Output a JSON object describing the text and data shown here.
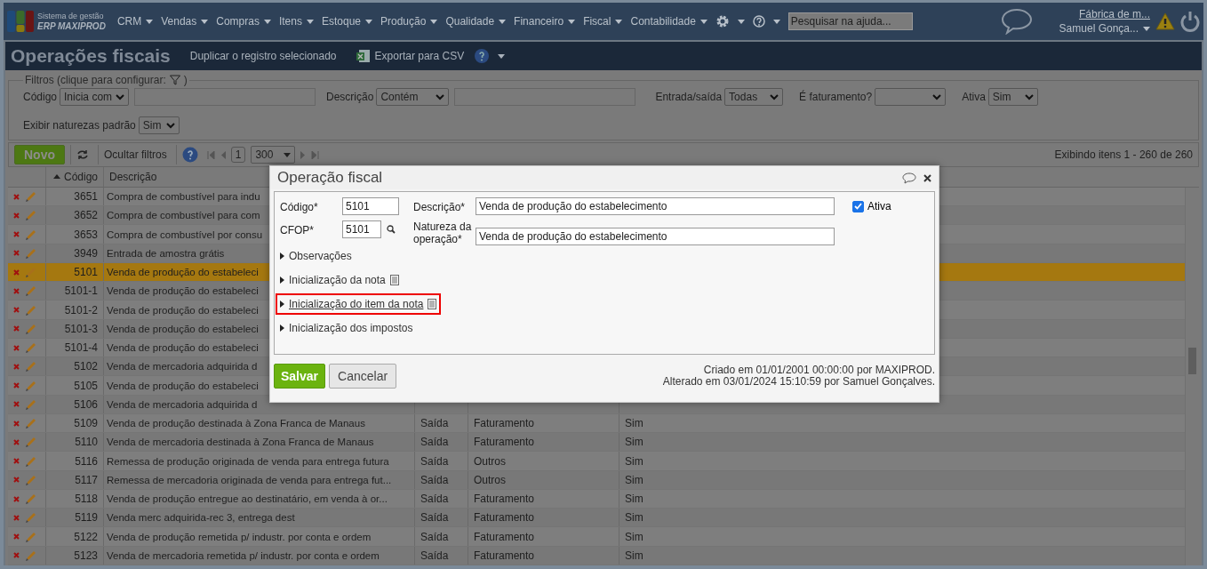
{
  "nav": {
    "brand_top": "Sistema de gestão",
    "brand_bottom": "ERP MAXIPROD",
    "menus": [
      "CRM",
      "Vendas",
      "Compras",
      "Itens",
      "Estoque",
      "Produção",
      "Qualidade",
      "Financeiro",
      "Fiscal",
      "Contabilidade"
    ],
    "search_placeholder": "Pesquisar na ajuda...",
    "company": "Fábrica de m...",
    "user": "Samuel Gonça..."
  },
  "page": {
    "title": "Operações fiscais",
    "actions": [
      "Duplicar o registro selecionado",
      "Exportar para CSV"
    ]
  },
  "filters": {
    "legend": "Filtros (clique para configurar:",
    "legend_end": ")",
    "fields": [
      {
        "label": "Código",
        "kind": "operator",
        "select": "Inicia com"
      },
      {
        "label": "Descrição",
        "kind": "operator",
        "select": "Contém"
      },
      {
        "label": "Entrada/saída",
        "kind": "select",
        "select": "Todas"
      },
      {
        "label": "É faturamento?",
        "kind": "select"
      },
      {
        "label": "Ativa",
        "kind": "select",
        "select": "Sim"
      },
      {
        "label": "Exibir naturezas padrão",
        "kind": "select",
        "select": "Sim"
      }
    ]
  },
  "toolbar": {
    "new_button": "Novo",
    "hide_filters": "Ocultar filtros",
    "page": "1",
    "page_size": "300",
    "status": "Exibindo itens 1 - 260 de 260"
  },
  "table": {
    "columns": [
      {
        "label": "Código",
        "sorted": true
      },
      {
        "label": "Descrição"
      }
    ],
    "rows": [
      {
        "code": "3651",
        "description": "Compra de combustível para indu",
        "selected": false
      },
      {
        "code": "3652",
        "description": "Compra de combustível para com",
        "selected": false
      },
      {
        "code": "3653",
        "description": "Compra de combustível por consu",
        "selected": false
      },
      {
        "code": "3949",
        "description": "Entrada de amostra grátis",
        "selected": false
      },
      {
        "code": "5101",
        "description": "Venda de produção do estabeleci",
        "selected": true
      },
      {
        "code": "5101-1",
        "description": "Venda de produção do estabeleci",
        "selected": false
      },
      {
        "code": "5101-2",
        "description": "Venda de produção do estabeleci",
        "selected": false
      },
      {
        "code": "5101-3",
        "description": "Venda de produção do estabeleci",
        "selected": false
      },
      {
        "code": "5101-4",
        "description": "Venda de produção do estabeleci",
        "selected": false
      },
      {
        "code": "5102",
        "description": "Venda de mercadoria adquirida d",
        "selected": false
      },
      {
        "code": "5105",
        "description": "Venda de produção do estabeleci",
        "selected": false
      },
      {
        "code": "5106",
        "description": "Venda de mercadoria adquirida d",
        "selected": false
      },
      {
        "code": "5109",
        "description": "Venda de produção destinada à Zona Franca de Manaus",
        "column_3": "Saída",
        "column_4": "Faturamento",
        "column_5": "Sim",
        "selected": false
      },
      {
        "code": "5110",
        "description": "Venda de mercadoria destinada à Zona Franca de Manaus",
        "column_3": "Saída",
        "column_4": "Faturamento",
        "column_5": "Sim",
        "selected": false
      },
      {
        "code": "5116",
        "description": "Remessa de produção originada de venda para entrega futura",
        "column_3": "Saída",
        "column_4": "Outros",
        "column_5": "Sim",
        "selected": false
      },
      {
        "code": "5117",
        "description": "Remessa de mercadoria originada de venda para entrega fut...",
        "column_3": "Saída",
        "column_4": "Outros",
        "column_5": "Sim",
        "selected": false
      },
      {
        "code": "5118",
        "description": "Venda de produção entregue ao destinatário, em venda à or...",
        "column_3": "Saída",
        "column_4": "Faturamento",
        "column_5": "Sim",
        "selected": false
      },
      {
        "code": "5119",
        "description": "Venda merc adquirida-rec 3, entrega dest",
        "column_3": "Saída",
        "column_4": "Faturamento",
        "column_5": "Sim",
        "selected": false
      },
      {
        "code": "5122",
        "description": "Venda de produção remetida p/ industr. por conta e ordem",
        "column_3": "Saída",
        "column_4": "Faturamento",
        "column_5": "Sim",
        "selected": false
      },
      {
        "code": "5123",
        "description": "Venda de mercadoria remetida p/ industr. por conta e ordem",
        "column_3": "Saída",
        "column_4": "Faturamento",
        "column_5": "Sim",
        "selected": false
      }
    ]
  },
  "dialog": {
    "title": "Operação fiscal",
    "code_label": "Código*",
    "code": "5101",
    "cfop_label": "CFOP*",
    "cfop": "5101",
    "description_label": "Descrição*",
    "description": "Venda de produção do estabelecimento",
    "nature_label": "Natureza da operação*",
    "nature": "Venda de produção do estabelecimento",
    "active_label": "Ativa",
    "active": true,
    "sections": [
      {
        "label": "Observações",
        "doc_icon": false,
        "highlighted": false
      },
      {
        "label": "Inicialização da nota",
        "doc_icon": true,
        "highlighted": false
      },
      {
        "label": "Inicialização do item da nota",
        "doc_icon": true,
        "highlighted": true
      },
      {
        "label": "Inicialização dos impostos",
        "doc_icon": false,
        "highlighted": false
      }
    ],
    "save": "Salvar",
    "cancel": "Cancelar",
    "created": "Criado em 01/01/2001 00:00:00 por MAXIPROD.",
    "modified": "Alterado em 03/01/2024 15:10:59 por Samuel Gonçalves."
  }
}
